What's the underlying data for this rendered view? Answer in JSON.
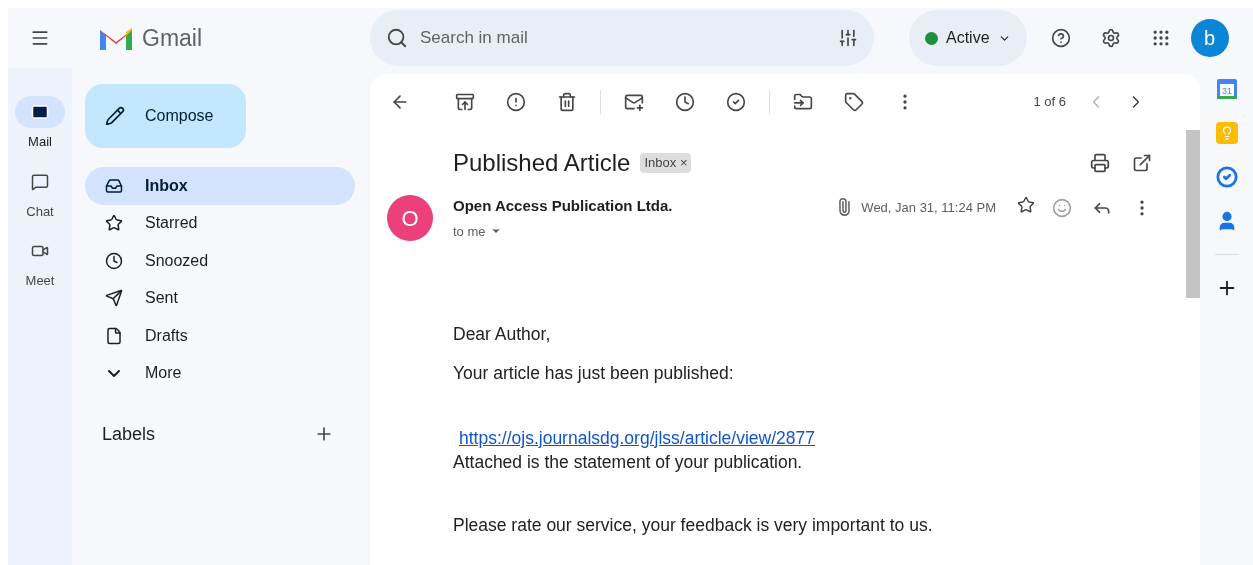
{
  "header": {
    "product_name": "Gmail",
    "search": {
      "placeholder": "Search in mail"
    },
    "status": {
      "label": "Active",
      "color": "#1e8e3e"
    },
    "avatar_letter": "b"
  },
  "rail": [
    {
      "kind": "mail",
      "label": "Mail",
      "selected": true
    },
    {
      "kind": "chat",
      "label": "Chat",
      "selected": false
    },
    {
      "kind": "meet",
      "label": "Meet",
      "selected": false
    }
  ],
  "compose": "Compose",
  "folders": [
    {
      "kind": "inbox",
      "label": "Inbox",
      "selected": true
    },
    {
      "kind": "star",
      "label": "Starred",
      "selected": false
    },
    {
      "kind": "clock",
      "label": "Snoozed",
      "selected": false
    },
    {
      "kind": "send",
      "label": "Sent",
      "selected": false
    },
    {
      "kind": "file",
      "label": "Drafts",
      "selected": false
    },
    {
      "kind": "more",
      "label": "More",
      "selected": false
    }
  ],
  "labels_heading": "Labels",
  "toolbar": {
    "pager": "1 of 6",
    "prev_disabled": true,
    "next_disabled": false
  },
  "message": {
    "subject": "Published Article",
    "label_chip": "Inbox",
    "label_chip_close": "×",
    "sender_initial": "O",
    "sender": "Open Access Publication Ltda.",
    "recipient": "to me",
    "has_attachment": true,
    "date": "Wed, Jan 31, 11:24 PM",
    "starred": false,
    "body": [
      [
        {
          "kind": "text",
          "text": "Dear Author,"
        }
      ],
      [
        {
          "kind": "text",
          "text": "Your article has just been published:"
        }
      ],
      [
        {
          "kind": "link",
          "text": "https://ojs.journalsdg.org/jlss/article/view/2877"
        },
        {
          "kind": "text",
          "text": "Attached is the statement of your publication."
        }
      ],
      [
        {
          "kind": "text",
          "text": "Please rate our service, your feedback is very important to us."
        }
      ]
    ]
  },
  "side_panel": {
    "calendar_day": "31"
  }
}
